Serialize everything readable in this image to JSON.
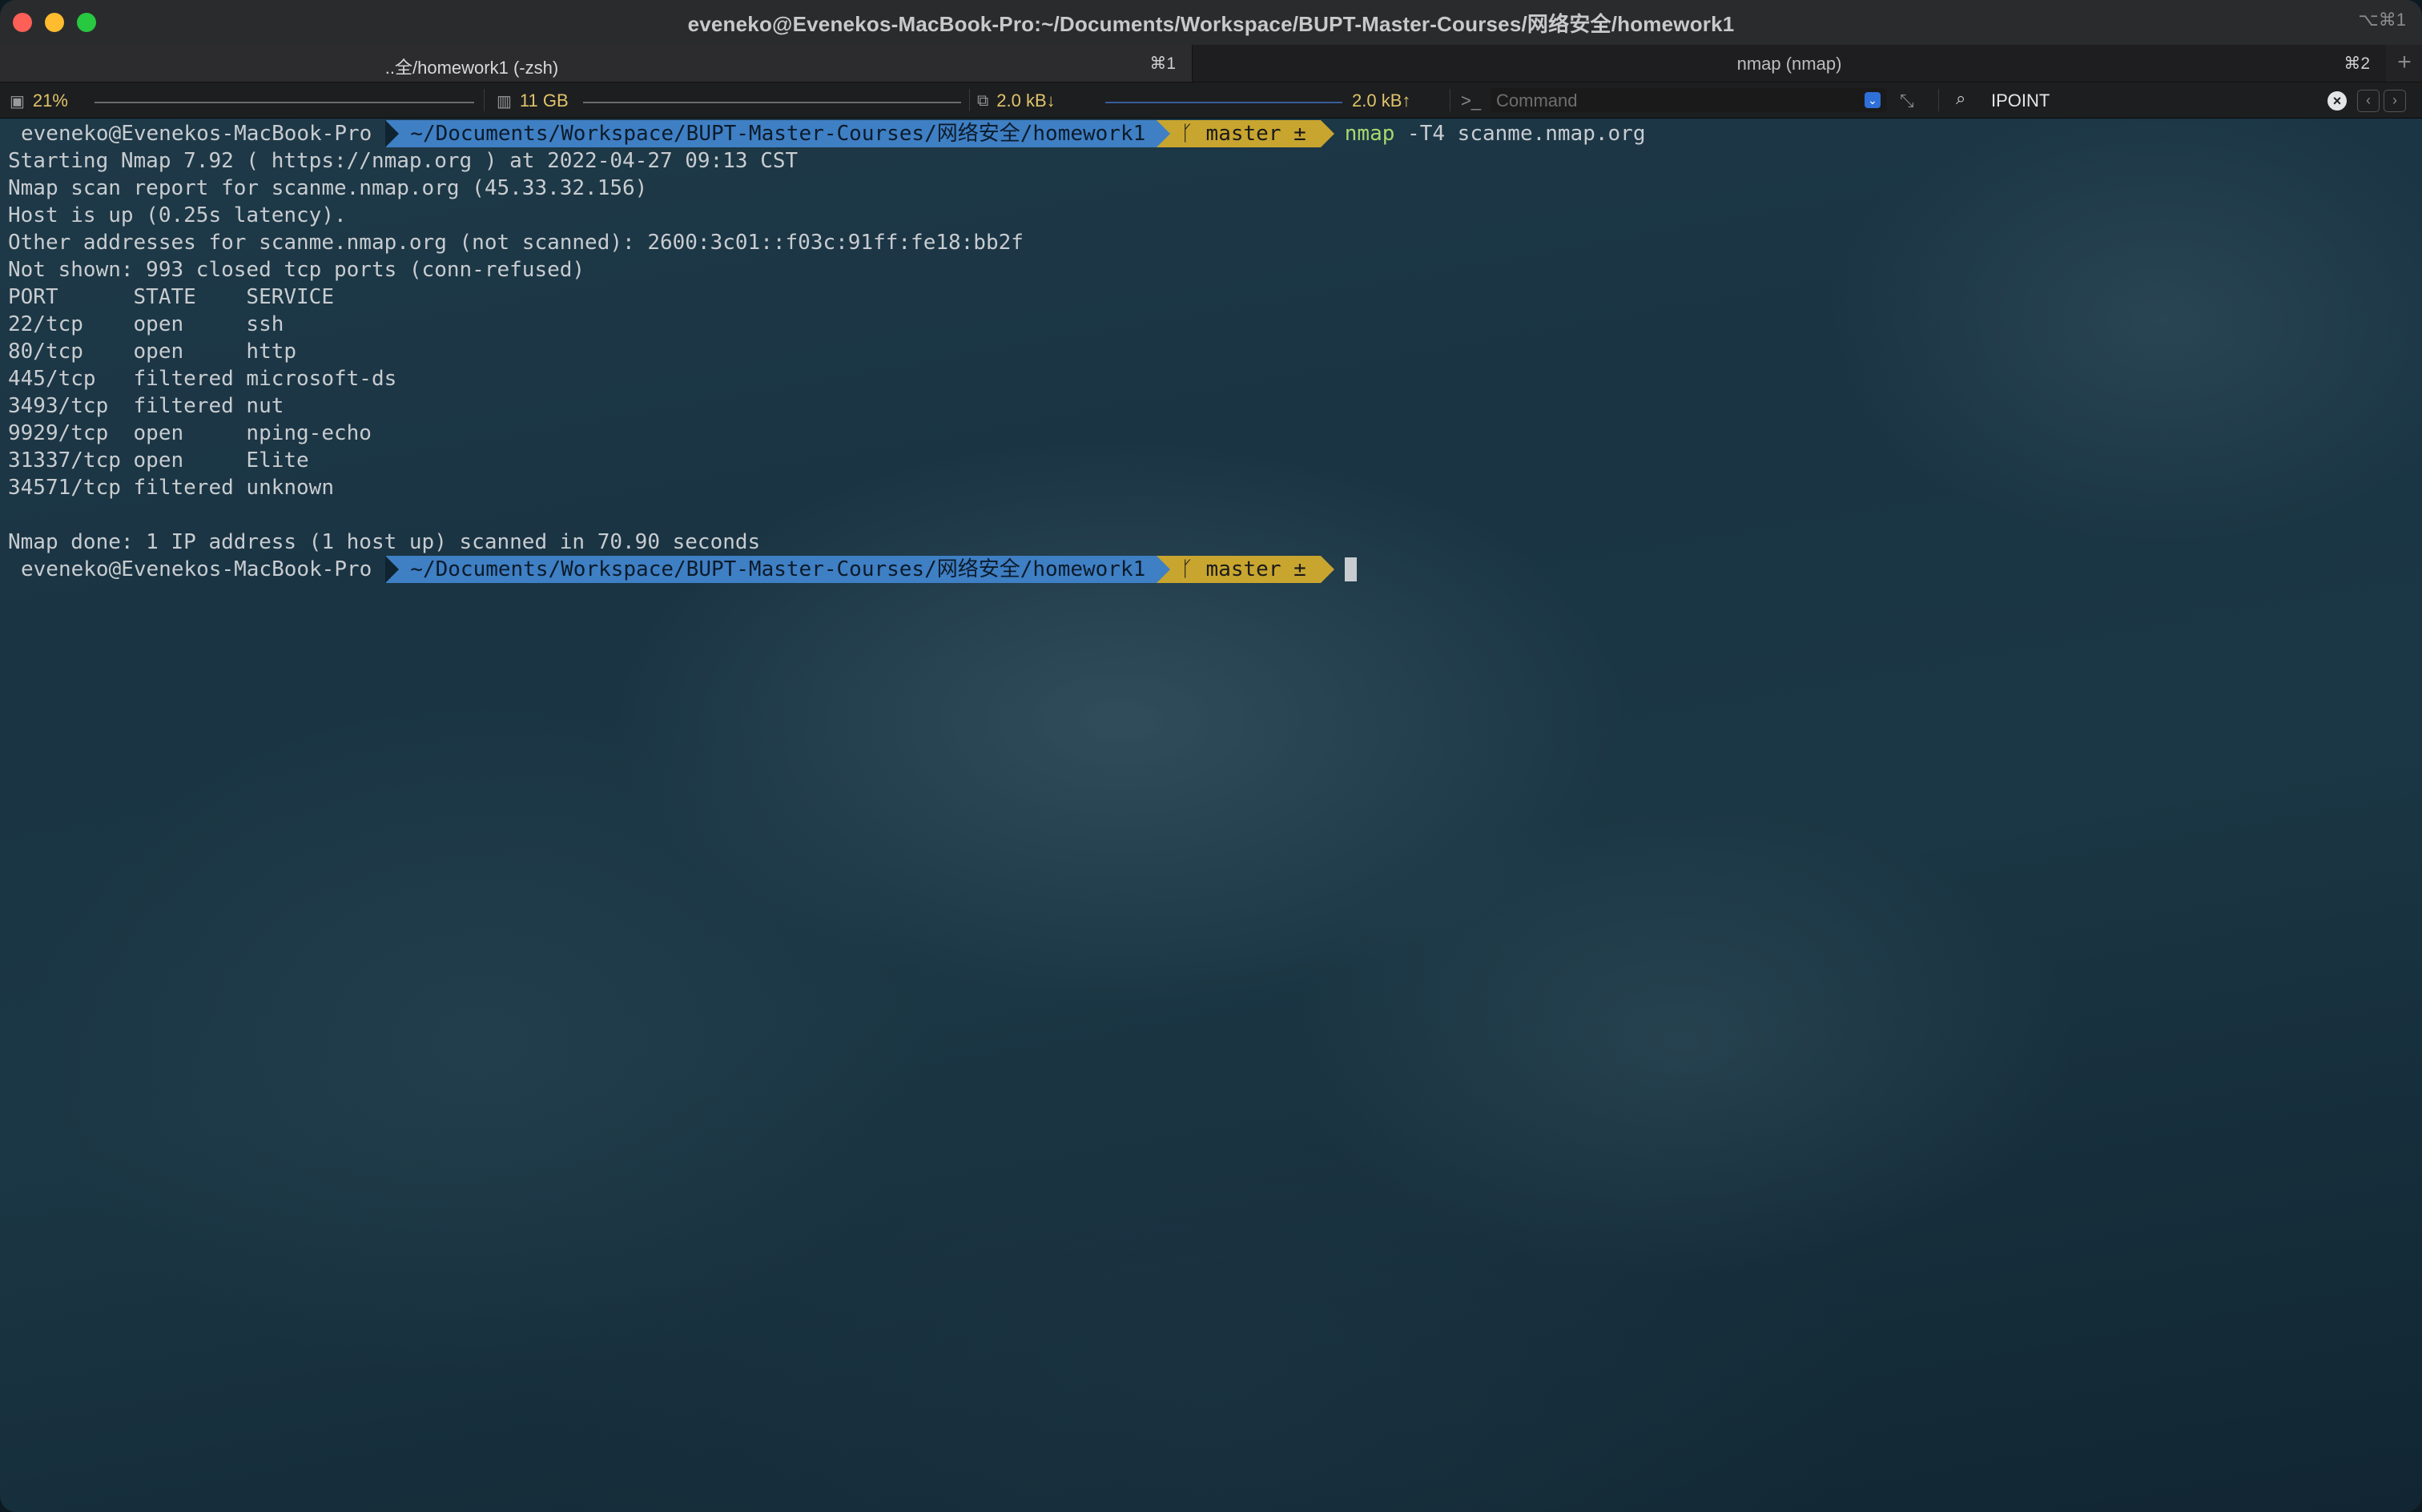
{
  "window": {
    "title": "eveneko@Evenekos-MacBook-Pro:~/Documents/Workspace/BUPT-Master-Courses/网络安全/homework1",
    "title_shortcut": "⌥⌘1"
  },
  "tabs": [
    {
      "label": "..全/homework1 (-zsh)",
      "shortcut": "⌘1"
    },
    {
      "label": "nmap (nmap)",
      "shortcut": "⌘2"
    }
  ],
  "tab_add_label": "+",
  "statusbar": {
    "cpu": "21%",
    "memory": "11 GB",
    "net_down": "2.0 kB↓",
    "net_up": "2.0 kB↑",
    "command_placeholder": "Command",
    "search_value": "IPOINT",
    "prev_label": "‹",
    "next_label": "›"
  },
  "prompt": {
    "user": "eveneko@Evenekos-MacBook-Pro",
    "dir": "~/Documents/Workspace/BUPT-Master-Courses/网络安全/homework1",
    "git": "master ±"
  },
  "command": {
    "bin": "nmap",
    "args": " -T4 scanme.nmap.org"
  },
  "output": [
    "Starting Nmap 7.92 ( https://nmap.org ) at 2022-04-27 09:13 CST",
    "Nmap scan report for scanme.nmap.org (45.33.32.156)",
    "Host is up (0.25s latency).",
    "Other addresses for scanme.nmap.org (not scanned): 2600:3c01::f03c:91ff:fe18:bb2f",
    "Not shown: 993 closed tcp ports (conn-refused)",
    "PORT      STATE    SERVICE",
    "22/tcp    open     ssh",
    "80/tcp    open     http",
    "445/tcp   filtered microsoft-ds",
    "3493/tcp  filtered nut",
    "9929/tcp  open     nping-echo",
    "31337/tcp open     Elite",
    "34571/tcp filtered unknown",
    "",
    "Nmap done: 1 IP address (1 host up) scanned in 70.90 seconds"
  ]
}
